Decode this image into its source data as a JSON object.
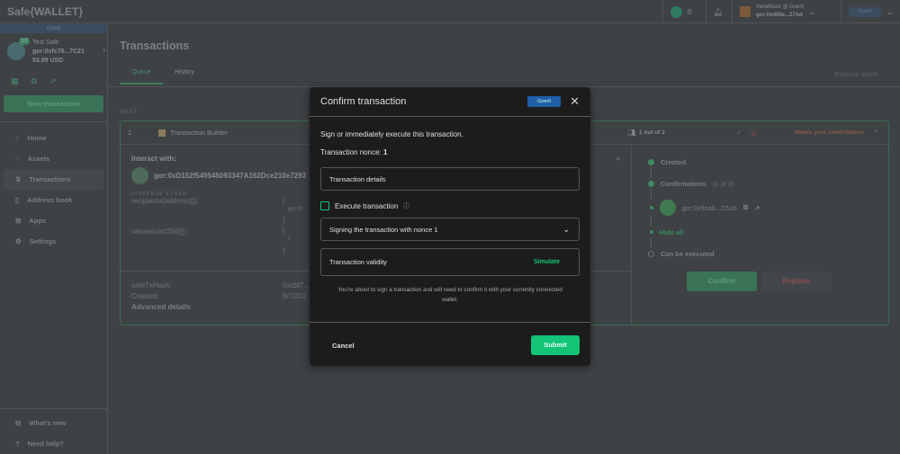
{
  "header": {
    "logo": "Safe{WALLET}",
    "pending_count": "0",
    "wallet_name": "MetaMask @ Goerli",
    "wallet_address": "gor:0xd09e...27Ad",
    "network": "Goerli"
  },
  "sidebar": {
    "network_banner": "Goerli",
    "safe_name": "Test Safe",
    "threshold": "2/2",
    "safe_address": "gor:0xfc76...7C21",
    "balance": "93.99 USD",
    "new_tx": "New transaction",
    "items": [
      {
        "label": "Home"
      },
      {
        "label": "Assets"
      },
      {
        "label": "Transactions"
      },
      {
        "label": "Address book"
      },
      {
        "label": "Apps"
      },
      {
        "label": "Settings"
      }
    ],
    "footer": [
      {
        "label": "What's new"
      },
      {
        "label": "Need help?"
      }
    ]
  },
  "main": {
    "title": "Transactions",
    "tabs": [
      "Queue",
      "History"
    ],
    "execute_batch": "Execute batch",
    "next_label": "NEXT",
    "tx": {
      "nonce": "1",
      "app": "Transaction Builder",
      "confirmations": "1 out of 2",
      "status": "Needs your confirmation",
      "interact_label": "Interact with:",
      "interact_address": "gor:0xD152f549545093347A162Dce210e7293",
      "method": "DISPERSE ETHER",
      "param1": "recipients(address[]):",
      "param2": "values(uint256[]):",
      "open_bracket": "[",
      "close_bracket": "]",
      "recipient_value": "gor:0x",
      "value_item": "1",
      "hash_label": "safeTxHash:",
      "hash_value": "0xcbf7...",
      "created_label": "Created:",
      "created_value": "6/7/202",
      "advanced": "Advanced details"
    },
    "steps": {
      "created": "Created",
      "confirmations": "Confirmations",
      "confirmations_count": "(1 of 2)",
      "signer": "gor:0x9ca3...C516",
      "hide_all": "Hide all",
      "can_execute": "Can be executed"
    },
    "confirm_btn": "Confirm",
    "replace_btn": "Replace"
  },
  "modal": {
    "title": "Confirm transaction",
    "network": "Goerli",
    "description": "Sign or immediately execute this transaction.",
    "nonce_label": "Transaction nonce:",
    "nonce_value": "1",
    "details": "Transaction details",
    "execute_label": "Execute transaction",
    "signing_option": "Signing the transaction with nonce 1",
    "validity": "Transaction validity",
    "simulate": "Simulate",
    "notice": "You're about to sign a transaction and will need to confirm it with your currently connected wallet.",
    "cancel": "Cancel",
    "submit": "Submit"
  },
  "colors": {
    "accent": "#12c476",
    "network": "#1e5fa8",
    "modal_bg": "#1c1c1c"
  }
}
